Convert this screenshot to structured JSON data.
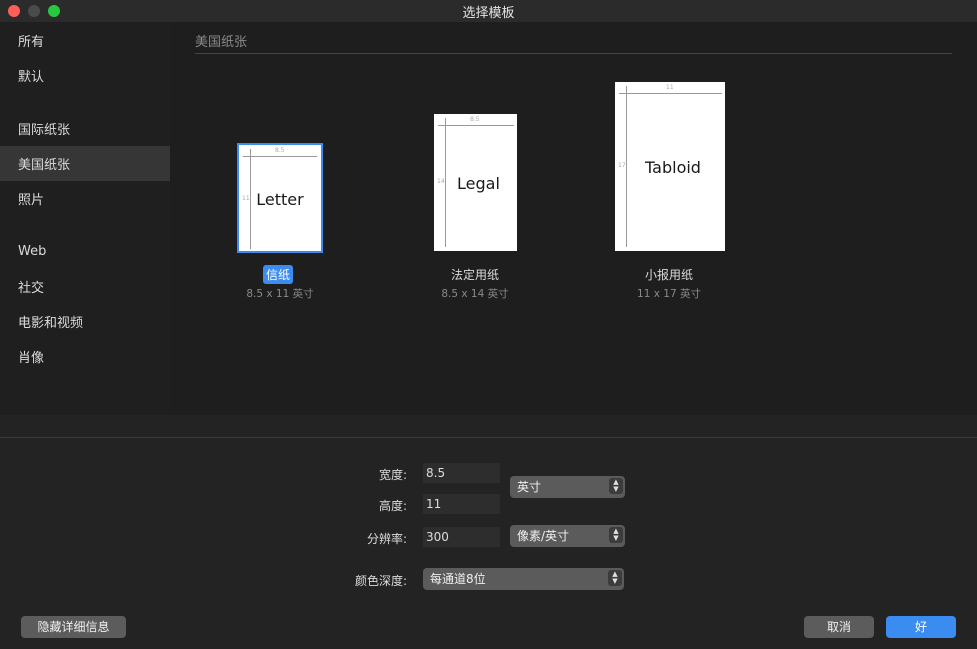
{
  "window": {
    "title": "选择模板"
  },
  "sidebar": {
    "items": [
      {
        "label": "所有"
      },
      {
        "label": "默认"
      },
      {
        "label": "国际纸张"
      },
      {
        "label": "美国纸张"
      },
      {
        "label": "照片"
      },
      {
        "label": "Web"
      },
      {
        "label": "社交"
      },
      {
        "label": "电影和视频"
      },
      {
        "label": "肖像"
      }
    ],
    "selected": "美国纸张"
  },
  "main": {
    "section_title": "美国纸张",
    "papers": [
      {
        "preview_label": "Letter",
        "name": "信纸",
        "size": "8.5 x 11 英寸",
        "dim_w": "8.5",
        "dim_h": "11",
        "selected": true
      },
      {
        "preview_label": "Legal",
        "name": "法定用纸",
        "size": "8.5 x 14 英寸",
        "dim_w": "8.5",
        "dim_h": "14",
        "selected": false
      },
      {
        "preview_label": "Tabloid",
        "name": "小报用纸",
        "size": "11 x 17 英寸",
        "dim_w": "11",
        "dim_h": "17",
        "selected": false
      }
    ]
  },
  "settings": {
    "width_label": "宽度:",
    "width_value": "8.5",
    "height_label": "高度:",
    "height_value": "11",
    "unit_select": "英寸",
    "resolution_label": "分辨率:",
    "resolution_value": "300",
    "resolution_unit_select": "像素/英寸",
    "color_depth_label": "颜色深度:",
    "color_depth_select": "每通道8位"
  },
  "footer": {
    "hide_details_label": "隐藏详细信息",
    "cancel_label": "取消",
    "ok_label": "好"
  },
  "colors": {
    "accent": "#3b8cf0",
    "close": "#fe5f57",
    "maximize": "#28c840"
  }
}
